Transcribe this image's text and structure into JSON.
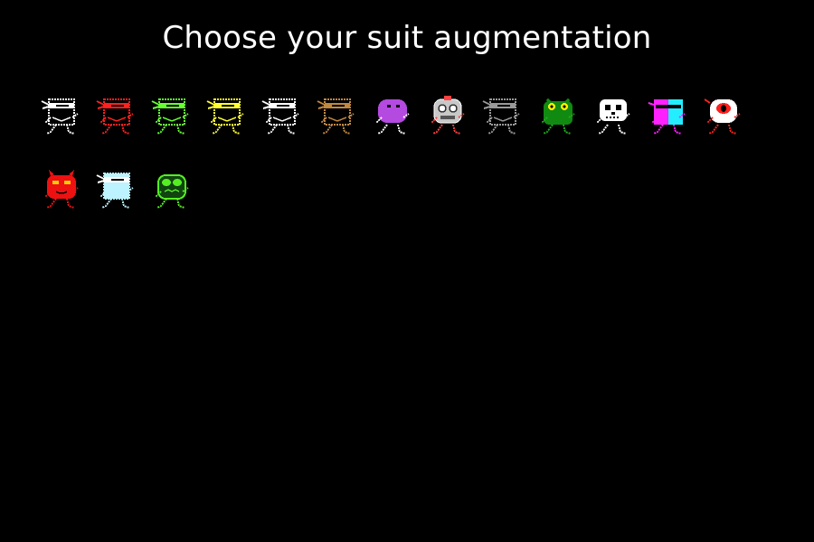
{
  "screen": {
    "title": "Choose your suit augmentation",
    "background": "#000000"
  },
  "suits": [
    {
      "id": "white-ninja",
      "kind": "ninja",
      "body": "#000000",
      "line": "#ffffff",
      "band": "#ffffff",
      "mask": "#000000"
    },
    {
      "id": "red-ninja",
      "kind": "ninja",
      "body": "#000000",
      "line": "#ff2020",
      "band": "#ff2020",
      "mask": "#000000"
    },
    {
      "id": "green-ninja",
      "kind": "ninja",
      "body": "#000000",
      "line": "#66ff33",
      "band": "#66ff33",
      "mask": "#000000"
    },
    {
      "id": "yellow-ninja",
      "kind": "ninja",
      "body": "#000000",
      "line": "#ffff33",
      "band": "#ffff33",
      "mask": "#000000"
    },
    {
      "id": "black-ninja",
      "kind": "ninja",
      "body": "#000000",
      "line": "#ffffff",
      "band": "#ffffff",
      "mask": "#111111"
    },
    {
      "id": "brown-ninja",
      "kind": "ninja",
      "body": "#000000",
      "line": "#c08840",
      "band": "#c08840",
      "mask": "#000000"
    },
    {
      "id": "purple-blob",
      "kind": "blob",
      "body": "#b44ae0",
      "line": "#ffffff",
      "band": "#ffffff",
      "mask": "#b44ae0"
    },
    {
      "id": "robot",
      "kind": "robot",
      "body": "#c8c8c8",
      "line": "#ff4040",
      "band": "#ffffff",
      "mask": "#000000"
    },
    {
      "id": "grey-ninja",
      "kind": "ninja",
      "body": "#000000",
      "line": "#9a9a9a",
      "band": "#9a9a9a",
      "mask": "#000000"
    },
    {
      "id": "green-frog",
      "kind": "frog",
      "body": "#118a11",
      "line": "#22aa22",
      "band": "#ffee00",
      "mask": "#118a11"
    },
    {
      "id": "skeleton",
      "kind": "skeleton",
      "body": "#ffffff",
      "line": "#ffffff",
      "band": "#000000",
      "mask": "#ffffff"
    },
    {
      "id": "magenta-cyan",
      "kind": "split",
      "body": "#ff22ff",
      "line": "#22eeff",
      "band": "#000000",
      "mask": "#ff22ff"
    },
    {
      "id": "cyclops",
      "kind": "cyclops",
      "body": "#ffffff",
      "line": "#ff2020",
      "band": "#ff2020",
      "mask": "#ffffff"
    },
    {
      "id": "red-devil",
      "kind": "devil",
      "body": "#ee1111",
      "line": "#ee1111",
      "band": "#ffcc00",
      "mask": "#ee1111"
    },
    {
      "id": "light-blue-ninja",
      "kind": "ninja",
      "body": "#bdf2ff",
      "line": "#bdf2ff",
      "band": "#ffffff",
      "mask": "#000000"
    },
    {
      "id": "green-goblin",
      "kind": "goblin",
      "body": "#000000",
      "line": "#55ee22",
      "band": "#55ee22",
      "mask": "#000000"
    }
  ]
}
